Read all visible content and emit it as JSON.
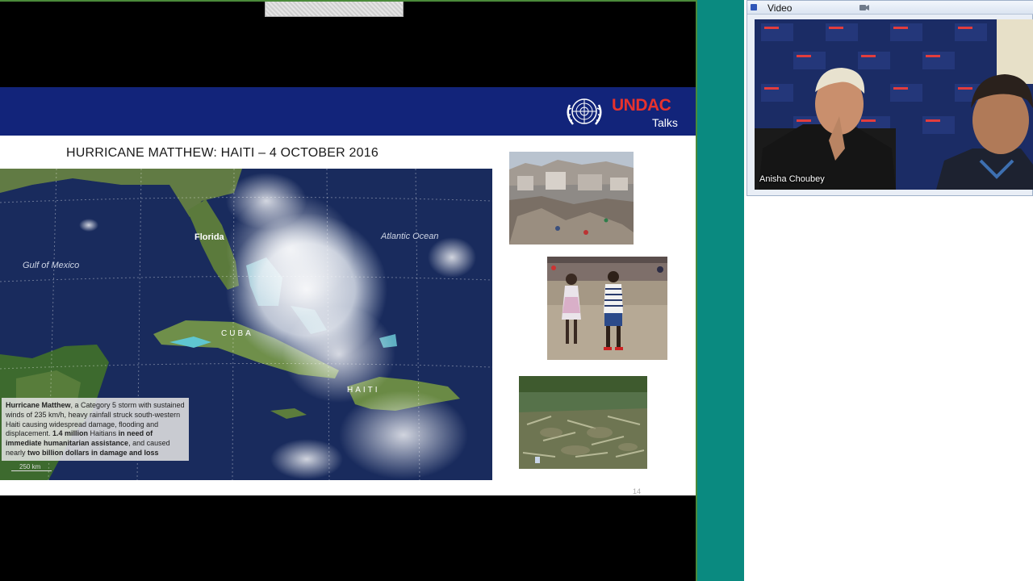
{
  "slide": {
    "brand_name": "UNDAC",
    "brand_sub": "Talks",
    "title": "HURRICANE MATTHEW: HAITI – 4 OCTOBER 2016",
    "map_labels": {
      "florida": "Florida",
      "atlantic": "Atlantic Ocean",
      "gulf": "Gulf of Mexico",
      "cuba": "CUBA",
      "haiti": "HAITI"
    },
    "scale_label": "250 km",
    "caption": {
      "p1_bold": "Hurricane Matthew",
      "p1": ", a Category 5 storm with sustained winds of 235 km/h, heavy rainfall struck south-western Haiti causing widespread damage, flooding and displacement. ",
      "p2_bold": "1.4 million",
      "p2": " Haitians ",
      "p3_bold": "in need of immediate humanitarian assistance",
      "p3": ", and caused nearly ",
      "p4_bold": "two billion dollars in damage and loss"
    },
    "slide_number": "14"
  },
  "video_pod": {
    "title": "Video",
    "participant_name": "Anisha Choubey"
  },
  "colors": {
    "slide_header": "#12247a",
    "brand_red": "#e8322d",
    "divider_teal": "#0a8a80"
  }
}
